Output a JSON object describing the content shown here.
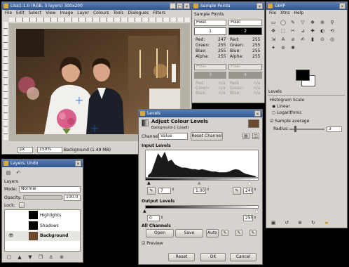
{
  "image_window": {
    "title": "Lisa1-1.0 (RGB, 3 layers) 300x200",
    "menu": [
      "File",
      "Edit",
      "Select",
      "View",
      "Image",
      "Layer",
      "Colours",
      "Tools",
      "Dialogues",
      "Filters"
    ],
    "unit": "px",
    "zoom": "150%",
    "status": "Background (1.49 MB)"
  },
  "sample_points": {
    "title": "Sample Points",
    "panel_label": "Sample Points",
    "mode_left": "Pixel",
    "mode_right": "Pixel",
    "point1": "1",
    "point2": "2",
    "channel_labels": [
      "Red:",
      "Green:",
      "Blue:",
      "Alpha:"
    ],
    "values1": [
      "247",
      "255",
      "255",
      "255"
    ],
    "values2": [
      "255",
      "255",
      "255",
      "255"
    ],
    "empty_label": "n/a",
    "point3": "3",
    "point4": "4"
  },
  "toolbox": {
    "title": "GIMP",
    "menu": [
      "File",
      "Xtns",
      "Help"
    ],
    "tools": [
      "▭",
      "◯",
      "✎",
      "▽",
      "❖",
      "⊕",
      "⚲",
      "✥",
      "⬚",
      "✂",
      "⊿",
      "✚",
      "◐",
      "⟲",
      "⇲",
      "A",
      "⌀",
      "✍",
      "▮",
      "⊙",
      "◎",
      "✦",
      "⊚",
      "✺"
    ],
    "panel_label": "Levels",
    "hist_scale_label": "Histogram Scale",
    "linear_label": "Linear",
    "log_label": "Logarithmic",
    "sample_avg_label": "Sample average",
    "radius_label": "Radius:",
    "radius_value": "3",
    "fg_color": "#000000",
    "bg_color": "#ffffff"
  },
  "layers": {
    "title": "Layers, Undo",
    "panel_label": "Layers",
    "mode_label": "Mode:",
    "mode_value": "Normal",
    "opacity_label": "Opacity:",
    "opacity_value": "100.0",
    "lock_label": "Lock:",
    "items": [
      {
        "name": "Highlights",
        "thumb": "#000000",
        "visible": false
      },
      {
        "name": "Shadows",
        "thumb": "#000000",
        "visible": false
      },
      {
        "name": "Background",
        "thumb": "#6b4a2f",
        "visible": true
      }
    ]
  },
  "levels": {
    "title": "Levels",
    "heading": "Adjust Colour Levels",
    "subheading": "Background-1 (Lisa8)",
    "channel_label": "Channel:",
    "channel_value": "Value",
    "reset_channel": "Reset Channel",
    "input_label": "Input Levels",
    "input_low": "7",
    "input_gamma": "1.00",
    "input_high": "240",
    "output_label": "Output Levels",
    "output_low": "0",
    "output_high": "255",
    "all_channels_label": "All Channels",
    "open": "Open",
    "save": "Save",
    "auto": "Auto",
    "preview": "Preview",
    "reset": "Reset",
    "ok": "OK",
    "cancel": "Cancel"
  },
  "chart_data": {
    "type": "area",
    "x": [
      0,
      8,
      16,
      24,
      32,
      40,
      48,
      56,
      64,
      72,
      80,
      88,
      96,
      104,
      112,
      120,
      128,
      136,
      144,
      152,
      160,
      168,
      176,
      184,
      192,
      200,
      208,
      216,
      224,
      232,
      240,
      248,
      255
    ],
    "values": [
      2,
      6,
      18,
      30,
      24,
      32,
      20,
      22,
      16,
      14,
      12,
      12,
      11,
      10,
      10,
      9,
      10,
      9,
      8,
      7,
      7,
      6,
      6,
      6,
      7,
      9,
      10,
      9,
      6,
      4,
      3,
      2,
      1
    ],
    "xlim": [
      0,
      255
    ]
  }
}
